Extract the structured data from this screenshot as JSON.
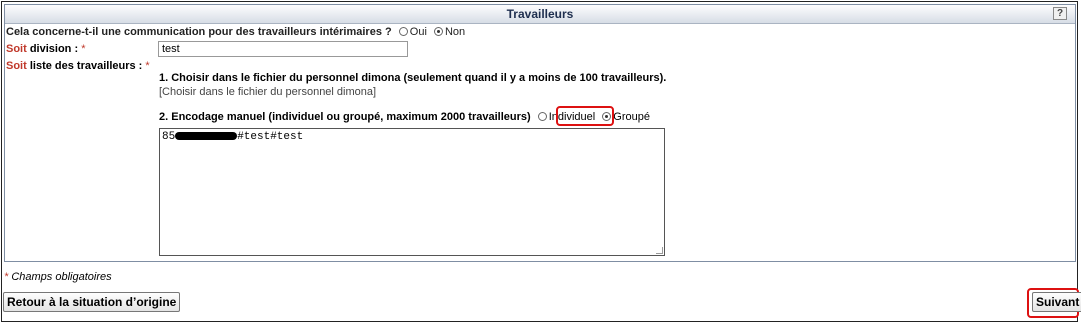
{
  "panel": {
    "title": "Travailleurs",
    "help_label": "?"
  },
  "interim_question": {
    "text": "Cela concerne-t-il une communication pour des travailleurs intérimaires ?",
    "options": [
      "Oui",
      "Non"
    ],
    "selected": "Non"
  },
  "division": {
    "prefix": "Soit",
    "label": " division :",
    "required_marker": "*",
    "value": "test"
  },
  "workers_list": {
    "prefix": "Soit",
    "label": " liste des travailleurs :",
    "required_marker": "*"
  },
  "option1": {
    "title": "1. Choisir dans le fichier du personnel dimona (seulement quand il y a moins de 100 travailleurs).",
    "link": "[Choisir dans le fichier du personnel dimona]"
  },
  "option2": {
    "title": "2. Encodage manuel (individuel ou groupé, maximum 2000 travailleurs)",
    "modes": [
      "Individuel",
      "Groupé"
    ],
    "selected": "Groupé",
    "textarea_prefix": "85",
    "textarea_suffix": "#test#test"
  },
  "footer": {
    "required_note_marker": "*",
    "required_note": " Champs obligatoires",
    "back_button": "Retour à la situation d’origine",
    "next_button": "Suivant"
  },
  "colors": {
    "required": "#c0392b",
    "highlight": "#dd1111",
    "header_text": "#1f2f4f"
  }
}
